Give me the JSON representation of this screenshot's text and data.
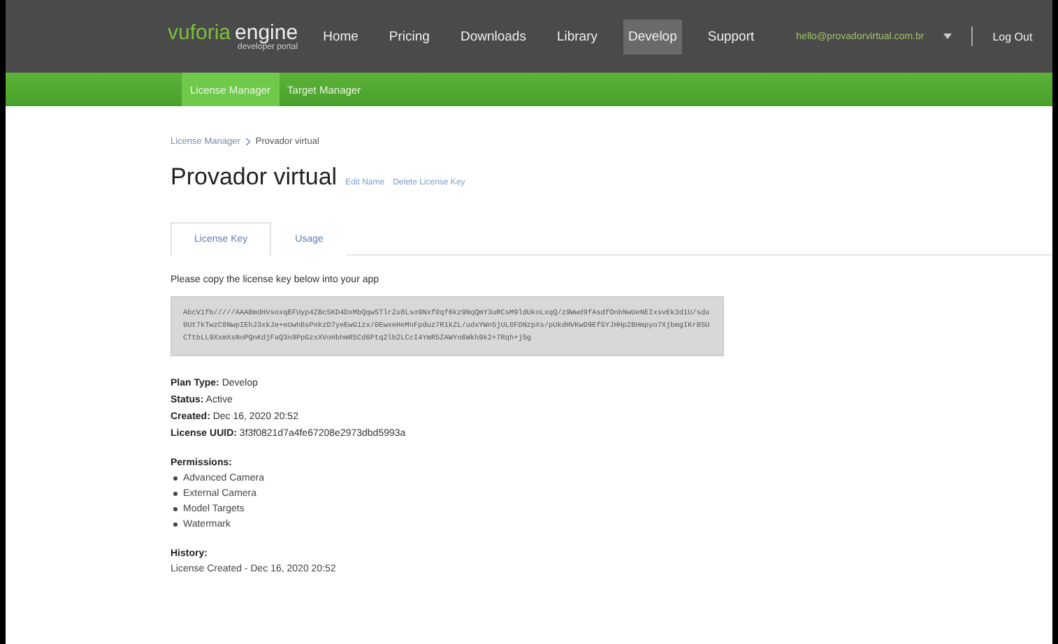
{
  "header": {
    "logo": "vuforia",
    "logo_word": "engine",
    "logo_sub": "developer portal",
    "nav": [
      {
        "label": "Home",
        "selected": false
      },
      {
        "label": "Pricing",
        "selected": false
      },
      {
        "label": "Downloads",
        "selected": false
      },
      {
        "label": "Library",
        "selected": false
      },
      {
        "label": "Develop",
        "selected": true
      },
      {
        "label": "Support",
        "selected": false
      }
    ],
    "user": "hello@provadorvirtual.com.br",
    "logout": "Log Out"
  },
  "subnav": [
    {
      "label": "License Manager",
      "selected": true
    },
    {
      "label": "Target Manager",
      "selected": false
    }
  ],
  "breadcrumb": [
    "License Manager",
    "Provador virtual"
  ],
  "title": "Provador virtual",
  "title_links": [
    "Edit Name",
    "Delete License Key"
  ],
  "tabs": [
    {
      "label": "License Key",
      "selected": true
    },
    {
      "label": "Usage",
      "selected": false
    }
  ],
  "instruction": "Please copy the license key below into your app",
  "license_key": "AbcV1fb/////AAABmdHVsoxqEFUyp4ZBcSKD4DxMbQqwSTlrZu8Lso9Nxf0qf6kz9NqQmY3uRCsM9ldUkoLxqQ/z9Wwd9fAsdfOnbNwUeNEIxsvEk3d1U/sdu0Ut7kTwzC8NwpIEhJ3xkJe+eUwhBsPnkzD7yeEwG1zx/0EwxeHeMnFpduz7R1kZL/udxYWn5jUL8FDNzpXs/pUkdHVKwD9EfGYJHHp2BHmpyo7XjbmgIKrB5UCTtbLL9XxmXsNoPQnKdjFaQ3n9PpGzxXVoHbhmR5Cd6Ptq2lb2LCcI4YmR5ZAWYo6Wkh9k2+7Rqh+j5g",
  "fields": [
    {
      "label": "Plan Type:",
      "value": "Develop"
    },
    {
      "label": "Status:",
      "value": "Active"
    },
    {
      "label": "Created:",
      "value": "Dec 16, 2020 20:52"
    },
    {
      "label": "License UUID:",
      "value": "3f3f0821d7a4fe67208e2973dbd5993a"
    }
  ],
  "permissions": {
    "label": "Permissions:",
    "items": [
      "Advanced Camera",
      "External Camera",
      "Model Targets",
      "Watermark"
    ]
  },
  "history": {
    "label": "History:",
    "items": [
      "License Created - Dec 16, 2020 20:52"
    ]
  }
}
